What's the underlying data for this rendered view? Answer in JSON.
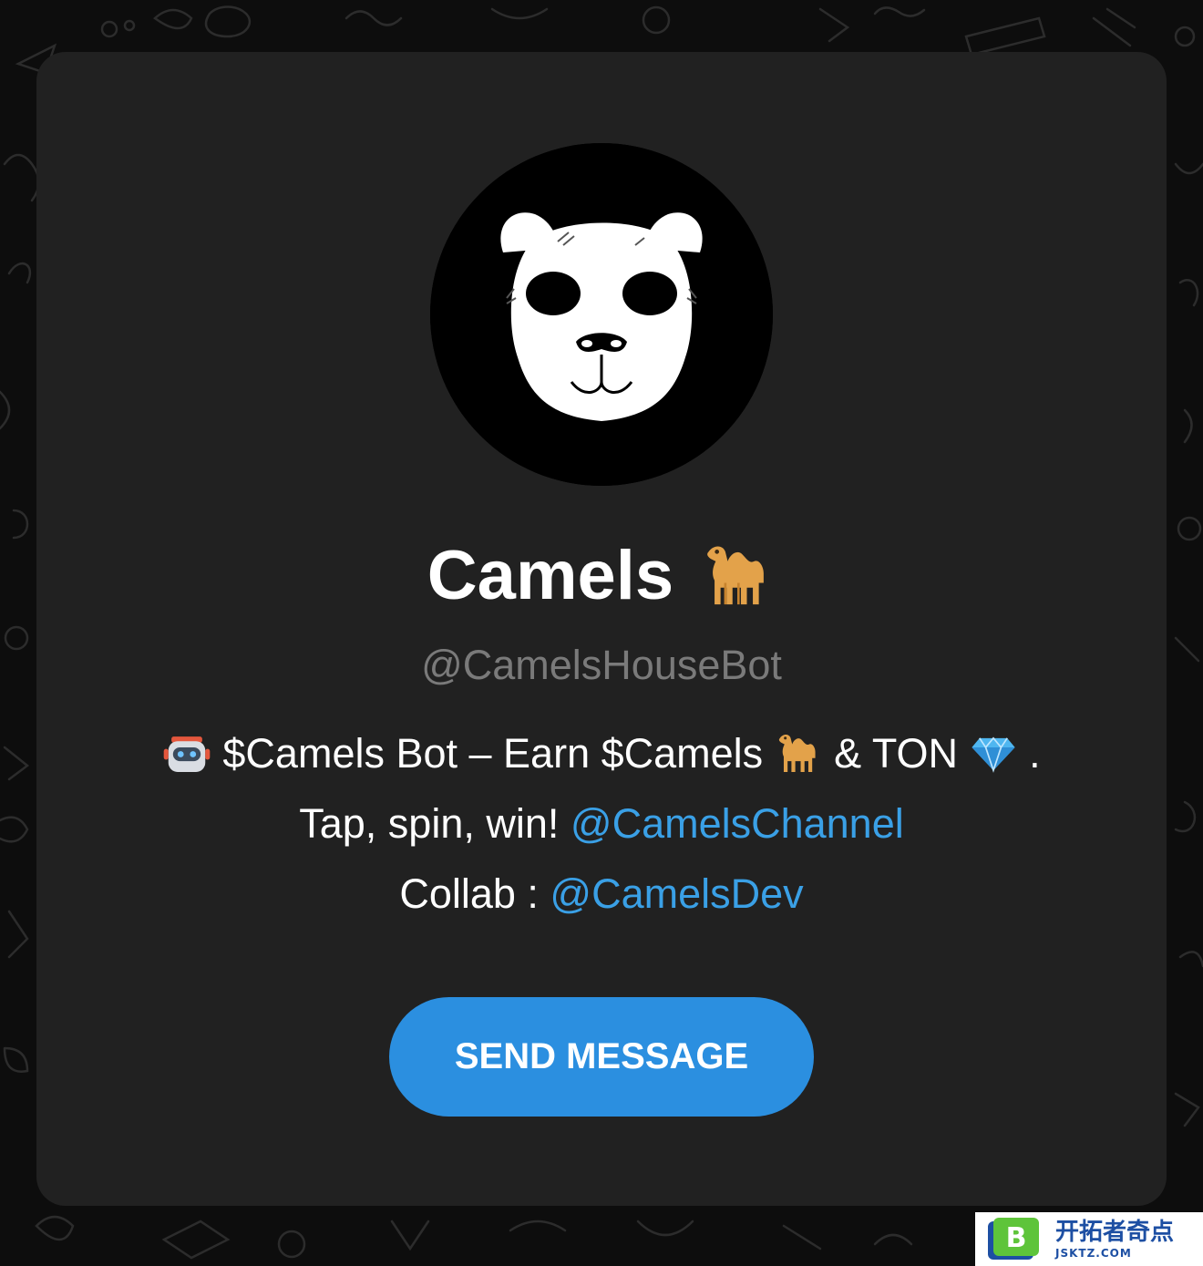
{
  "profile": {
    "name": "Camels",
    "title_emoji": "camel-emoji",
    "username": "@CamelsHouseBot"
  },
  "bio": {
    "line1_text_a": "$Camels Bot – Earn $Camels",
    "line1_text_b": "& TON",
    "line1_end": ".",
    "line2_text": "Tap, spin, win!",
    "line2_link": "@CamelsChannel",
    "line3_text": "Collab :",
    "line3_link": "@CamelsDev"
  },
  "actions": {
    "send_message_label": "SEND MESSAGE"
  },
  "watermark": {
    "logo_letter": "B",
    "cn_text": "开拓者奇点",
    "en_text": "JSKTZ.COM"
  },
  "colors": {
    "card_background": "#212121",
    "link": "#3aa0e6",
    "button": "#2b8fe0",
    "username": "#7a7a7a"
  }
}
